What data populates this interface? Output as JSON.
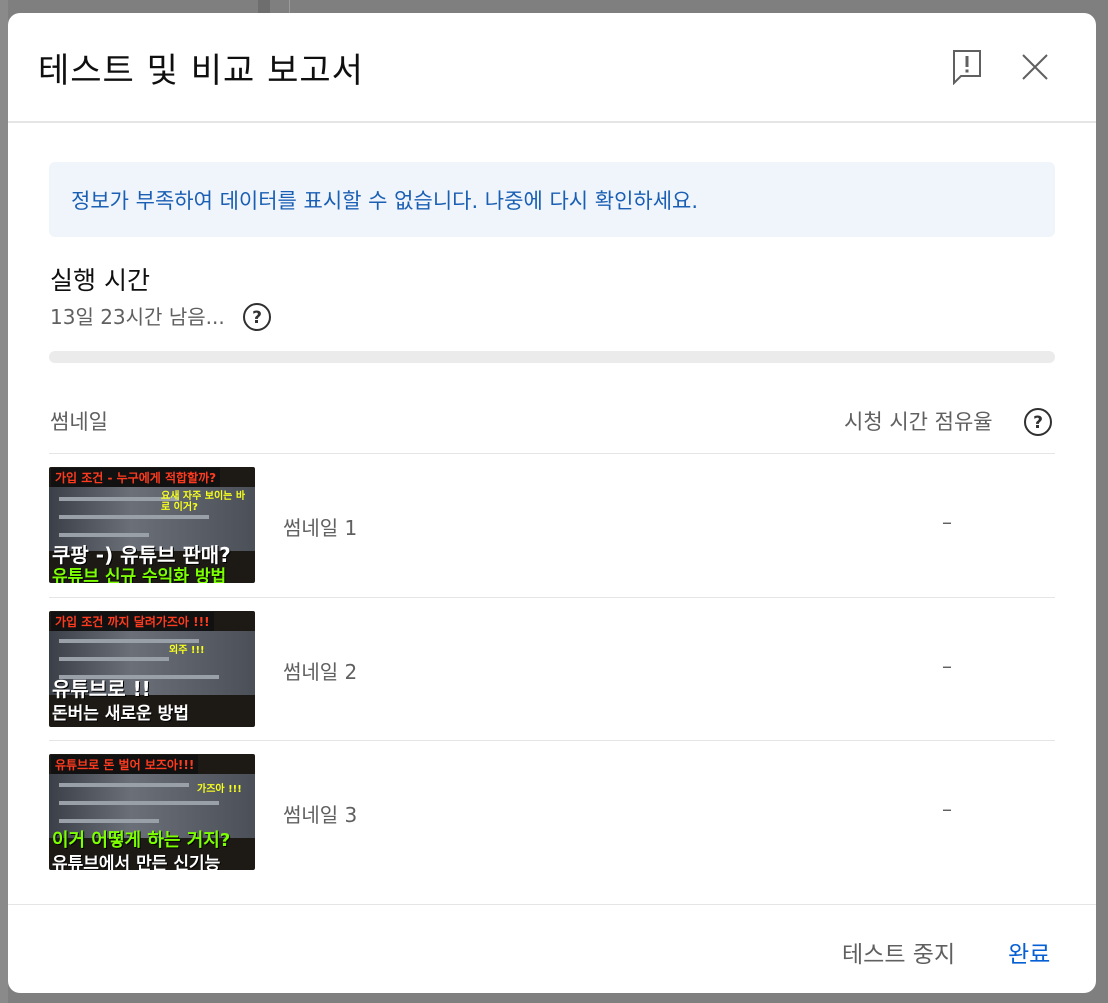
{
  "dialog": {
    "title": "테스트 및 비교 보고서",
    "feedback_icon": "report-feedback-icon",
    "close_icon": "close-icon"
  },
  "banner": {
    "message": "정보가 부족하여 데이터를 표시할 수 없습니다. 나중에 다시 확인하세요."
  },
  "runtime": {
    "title": "실행 시간",
    "remaining": "13일 23시간 남음...",
    "progress": 0.0
  },
  "table": {
    "col_thumbnail": "썸네일",
    "col_watch_share": "시청 시간 점유율",
    "rows": [
      {
        "label": "썸네일 1",
        "value": "–",
        "thumb": {
          "top": "가입 조건 - 누구에게 적합할까?",
          "mid": "요새 자주 보이는 바로 이거?",
          "line1": "쿠팡 -) 유튜브 판매?",
          "line2": "유튜브 신규 수익화 방법"
        }
      },
      {
        "label": "썸네일 2",
        "value": "–",
        "thumb": {
          "top": "가입 조건 까지 달려가즈아 !!!",
          "mid": "외주 !!!",
          "line1": "유튜브로 !!",
          "line2": "돈버는 새로운 방법"
        }
      },
      {
        "label": "썸네일 3",
        "value": "–",
        "thumb": {
          "top": "유튜브로 돈 벌어 보즈아!!!",
          "mid": "가즈아 !!!",
          "line1": "이거 어떻게 하는 거지?",
          "line2": "유튜브에서 만든 신기능"
        }
      }
    ]
  },
  "footer": {
    "stop_label": "테스트 중지",
    "done_label": "완료"
  },
  "colors": {
    "accent": "#065fd4",
    "banner_bg": "#f0f5fb",
    "banner_text": "#1a5fb4",
    "thumb_green": "#7cff00",
    "thumb_red": "#ff3b1f"
  }
}
